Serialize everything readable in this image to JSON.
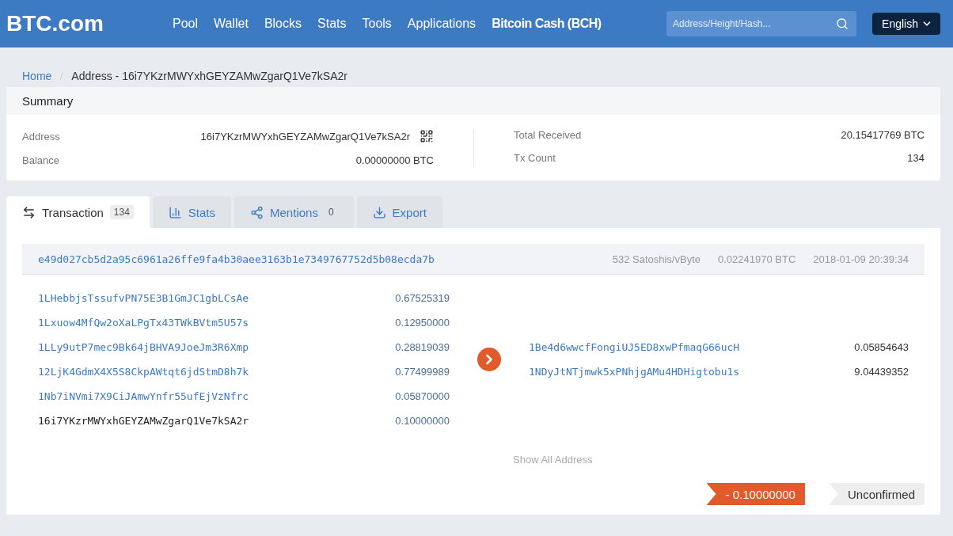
{
  "header": {
    "logo": "BTC.com",
    "nav": [
      {
        "label": "Pool",
        "bold": false
      },
      {
        "label": "Wallet",
        "bold": false
      },
      {
        "label": "Blocks",
        "bold": false
      },
      {
        "label": "Stats",
        "bold": false
      },
      {
        "label": "Tools",
        "bold": false
      },
      {
        "label": "Applications",
        "bold": false
      },
      {
        "label": "Bitcoin Cash (BCH)",
        "bold": true
      }
    ],
    "search": {
      "placeholder": "Address/Height/Hash..."
    },
    "language": "English"
  },
  "breadcrumb": [
    {
      "label": "Home",
      "link": true
    },
    {
      "label": "Address - 16i7YKzrMWYxhGEYZAMwZgarQ1Ve7kSA2r",
      "link": false
    }
  ],
  "summary": {
    "title": "Summary",
    "left": [
      {
        "label": "Address",
        "value": "16i7YKzrMWYxhGEYZAMwZgarQ1Ve7kSA2r",
        "qr": true
      },
      {
        "label": "Balance",
        "value": "0.00000000 BTC",
        "qr": false
      }
    ],
    "right": [
      {
        "label": "Total Received",
        "value": "20.15417769 BTC"
      },
      {
        "label": "Tx Count",
        "value": "134"
      }
    ]
  },
  "tabs": [
    {
      "label": "Transaction",
      "count": "134",
      "kind": "swap",
      "selected": true
    },
    {
      "label": "Stats",
      "kind": "chart",
      "selected": false
    },
    {
      "label": "Mentions",
      "count": "0",
      "kind": "share",
      "selected": false
    },
    {
      "label": "Export",
      "kind": "download",
      "selected": false
    }
  ],
  "transaction": {
    "hash": "e49d027cb5d2a95c6961a26ffe9fa4b30aee3163b1e7349767752d5b08ecda7b",
    "fee_rate": "532 Satoshis/vByte",
    "fee": "0.02241970 BTC",
    "time": "2018-01-09 20:39:34",
    "inputs": [
      {
        "address": "1LHebbjsTssufvPN75E3B1GmJC1gbLCsAe",
        "amount": "0.67525319",
        "current": false
      },
      {
        "address": "1Lxuow4MfQw2oXaLPgTx43TWkBVtm5U57s",
        "amount": "0.12950000",
        "current": false
      },
      {
        "address": "1LLy9utP7mec9Bk64jBHVA9JoeJm3R6Xmp",
        "amount": "0.28819039",
        "current": false
      },
      {
        "address": "12LjK4GdmX4X5S8CkpAWtqt6jdStmD8h7k",
        "amount": "0.77499989",
        "current": false
      },
      {
        "address": "1Nb7iNVmi7X9CiJAmwYnfr55ufEjVzNfrc",
        "amount": "0.05870000",
        "current": false
      },
      {
        "address": "16i7YKzrMWYxhGEYZAMwZgarQ1Ve7kSA2r",
        "amount": "0.10000000",
        "current": true
      }
    ],
    "outputs": [
      {
        "address": "1Be4d6wwcfFongiUJ5ED8xwPfmaqG66ucH",
        "amount": "0.05854643",
        "current": false
      },
      {
        "address": "1NDyJtNTjmwk5xPNhjgAMu4HDHigtobu1s",
        "amount": "9.04439352",
        "current": false
      }
    ],
    "show_all": "Show All Address",
    "change": "- 0.10000000",
    "status": "Unconfirmed"
  }
}
